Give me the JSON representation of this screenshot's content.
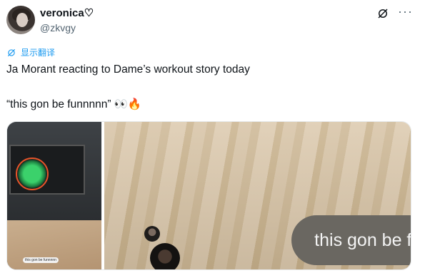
{
  "post": {
    "display_name": "veronica♡",
    "handle": "@zkvgy",
    "translate_label": "显示翻译",
    "text_line1": "Ja Morant reacting to Dame’s workout story today",
    "text_line2": "“this gon be funnnnn”",
    "emojis": "👀🔥"
  },
  "media": {
    "thumb_caption": "this gon be funnnnn",
    "bubble_text": "this gon be funnnnn"
  },
  "icons": {
    "header_grok": "grok-icon",
    "header_more": "more-icon",
    "translate": "translate-icon"
  }
}
